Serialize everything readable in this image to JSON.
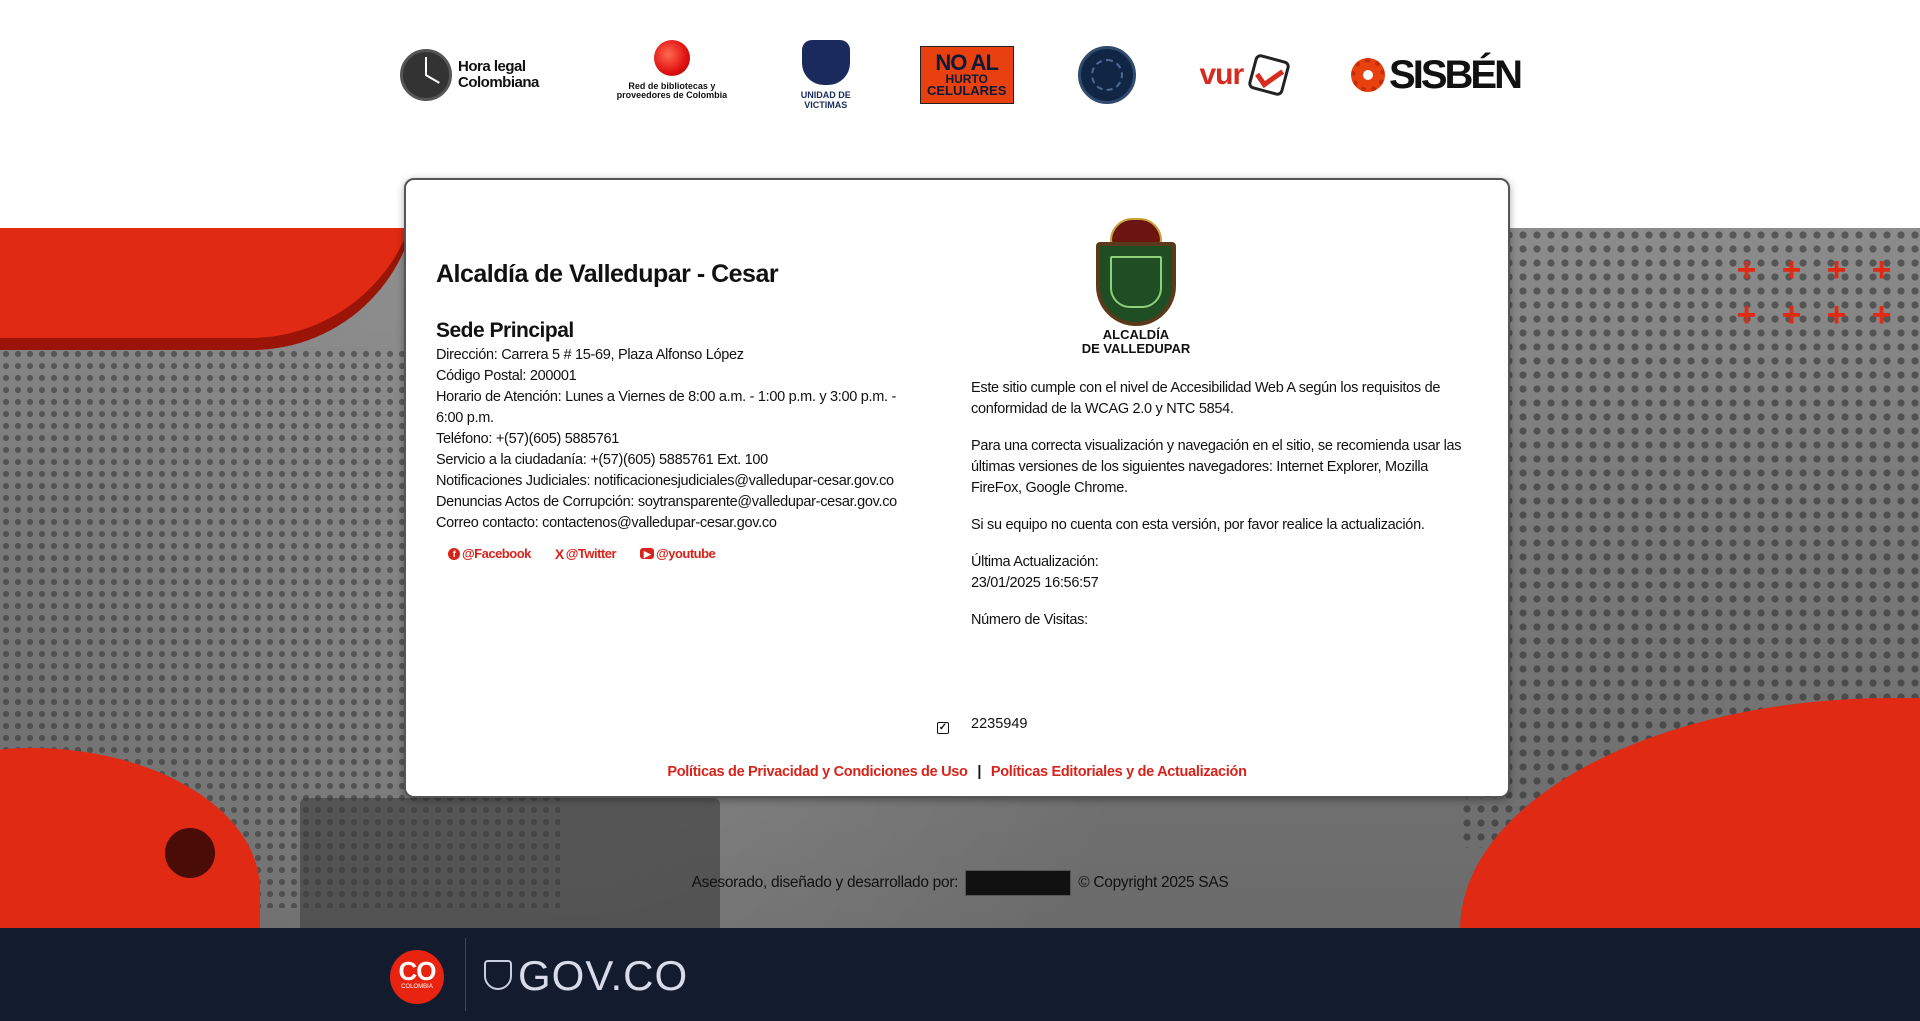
{
  "logos": [
    {
      "name": "hora-legal",
      "text": "Hora legal Colombiana"
    },
    {
      "name": "red-bibliotecas",
      "text": "Red de bibliotecas y proveedores de Colombia"
    },
    {
      "name": "unidad",
      "text": "UNIDAD DE VICTIMAS"
    },
    {
      "name": "no-hurto",
      "line1": "NO AL",
      "line2": "HURTO",
      "line3": "CELULARES"
    },
    {
      "name": "seal"
    },
    {
      "name": "vur",
      "text": "vur"
    },
    {
      "name": "sisben",
      "text": "SISBÉN"
    }
  ],
  "org": {
    "title": "Alcaldía de Valledupar - Cesar",
    "sede_title": "Sede Principal",
    "lines": [
      "Dirección: Carrera 5 # 15-69, Plaza Alfonso López",
      "Código Postal: 200001",
      "Horario de Atención: Lunes a Viernes de 8:00 a.m. - 1:00 p.m. y 3:00 p.m. - 6:00 p.m.",
      "Teléfono: +(57)(605) 5885761",
      "Servicio a la ciudadanía: +(57)(605) 5885761 Ext. 100",
      "Notificaciones Judiciales: notificacionesjudiciales@valledupar-cesar.gov.co",
      "Denuncias Actos de Corrupción: soytransparente@valledupar-cesar.gov.co",
      "Correo contacto: contactenos@valledupar-cesar.gov.co"
    ]
  },
  "social": {
    "facebook": "@Facebook",
    "twitter": "@Twitter",
    "youtube": "@youtube"
  },
  "crest": {
    "label_line1": "ALCALDÍA",
    "label_line2": "DE VALLEDUPAR"
  },
  "right": {
    "accessibility": "Este sitio cumple con el nivel de Accesibilidad Web A según los requisitos de conformidad de la WCAG 2.0 y NTC 5854.",
    "browsers": "Para una correcta visualización y navegación en el sitio, se recomienda usar las últimas versiones de los siguientes navegadores: Internet Explorer, Mozilla FireFox, Google Chrome.",
    "update_note": "Si su equipo no cuenta con esta versión, por favor realice la actualización.",
    "last_update_label": "Última Actualización:",
    "last_update_value": "23/01/2025 16:56:57",
    "visits_label": "Número de Visitas:",
    "visits_value": "2235949"
  },
  "policies": {
    "privacy": "Políticas de Privacidad y Condiciones de Uso",
    "separator": "|",
    "editorial": "Políticas Editoriales y de Actualización"
  },
  "credit": {
    "prefix": "Asesorado, diseñado y desarrollado por:",
    "suffix": "© Copyright 2025 SAS"
  },
  "gov": {
    "co": "CO",
    "colombia": "COLOMBIA",
    "label": "GOV.CO",
    "footer_bg": "#131c2e"
  },
  "colors": {
    "accent_red": "#d8231a",
    "text": "#111111"
  }
}
